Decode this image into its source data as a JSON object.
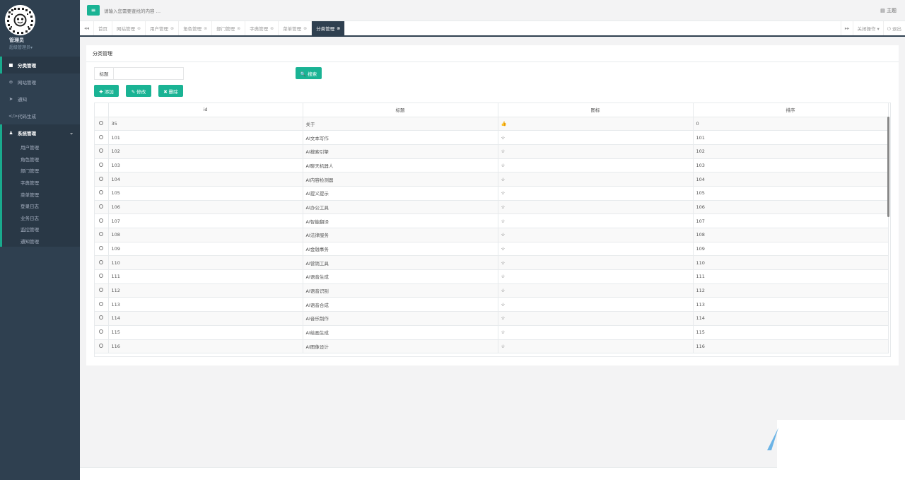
{
  "sidebar": {
    "user_name": "管理员",
    "user_role": "超级管理员",
    "user_role_caret": "▾",
    "items": [
      {
        "label": "分类管理",
        "icon": "square-icon",
        "glyph": "■"
      },
      {
        "label": "网站管理",
        "icon": "globe-icon",
        "glyph": "⊕"
      },
      {
        "label": "通知",
        "icon": "paper-plane-icon",
        "glyph": "➤"
      },
      {
        "label": "代码生成",
        "icon": "code-icon",
        "glyph": "</>"
      }
    ],
    "group": {
      "label": "系统管理",
      "icon": "user-icon",
      "glyph": "♟",
      "caret": "⌄"
    },
    "sub_items": [
      "用户管理",
      "角色管理",
      "部门管理",
      "字典管理",
      "菜单管理",
      "登录日志",
      "业务日志",
      "监控管理",
      "通知管理"
    ]
  },
  "topbar": {
    "menu_glyph": "≡",
    "search_placeholder": "请输入您需要查找的内容 …",
    "theme_label": "▤ 主题"
  },
  "tabs": {
    "prev_glyph": "◂◂",
    "next_glyph": "▸▸",
    "items": [
      "首页",
      "网站管理",
      "用户管理",
      "角色管理",
      "部门管理",
      "字典管理",
      "菜单管理",
      "分类管理"
    ],
    "close_glyph": "⊗",
    "close_ops": "关闭操作 ▾",
    "logout": "⏻ 退出"
  },
  "panel": {
    "title": "分类管理",
    "filter_label": "标题",
    "search_btn": "🔍 搜索",
    "add_btn": "✚ 添加",
    "edit_btn": "✎ 修改",
    "delete_btn": "✖ 删除"
  },
  "table": {
    "columns": [
      "id",
      "标题",
      "图标",
      "排序"
    ],
    "rows": [
      {
        "id": "35",
        "title": "关于",
        "icon": "👍",
        "sort": "0"
      },
      {
        "id": "101",
        "title": "AI文本写作",
        "icon": "☆",
        "sort": "101"
      },
      {
        "id": "102",
        "title": "AI搜索引擎",
        "icon": "☆",
        "sort": "102"
      },
      {
        "id": "103",
        "title": "AI聊天机器人",
        "icon": "☆",
        "sort": "103"
      },
      {
        "id": "104",
        "title": "AI内容检测器",
        "icon": "☆",
        "sort": "104"
      },
      {
        "id": "105",
        "title": "AI提义提示",
        "icon": "☆",
        "sort": "105"
      },
      {
        "id": "106",
        "title": "AI办公工具",
        "icon": "☆",
        "sort": "106"
      },
      {
        "id": "107",
        "title": "AI智能翻译",
        "icon": "☆",
        "sort": "107"
      },
      {
        "id": "108",
        "title": "AI法律服务",
        "icon": "☆",
        "sort": "108"
      },
      {
        "id": "109",
        "title": "AI金融事务",
        "icon": "☆",
        "sort": "109"
      },
      {
        "id": "110",
        "title": "AI营销工具",
        "icon": "☆",
        "sort": "110"
      },
      {
        "id": "111",
        "title": "AI语音生成",
        "icon": "☆",
        "sort": "111"
      },
      {
        "id": "112",
        "title": "AI语音识别",
        "icon": "☆",
        "sort": "112"
      },
      {
        "id": "113",
        "title": "AI语音合成",
        "icon": "☆",
        "sort": "113"
      },
      {
        "id": "114",
        "title": "AI音乐制作",
        "icon": "☆",
        "sort": "114"
      },
      {
        "id": "115",
        "title": "AI绘画生成",
        "icon": "☆",
        "sort": "115"
      },
      {
        "id": "116",
        "title": "AI图像设计",
        "icon": "☆",
        "sort": "116"
      }
    ]
  },
  "colors": {
    "accent": "#1ab394",
    "sidebar": "#2f4050",
    "sidebar_active": "#293846"
  }
}
